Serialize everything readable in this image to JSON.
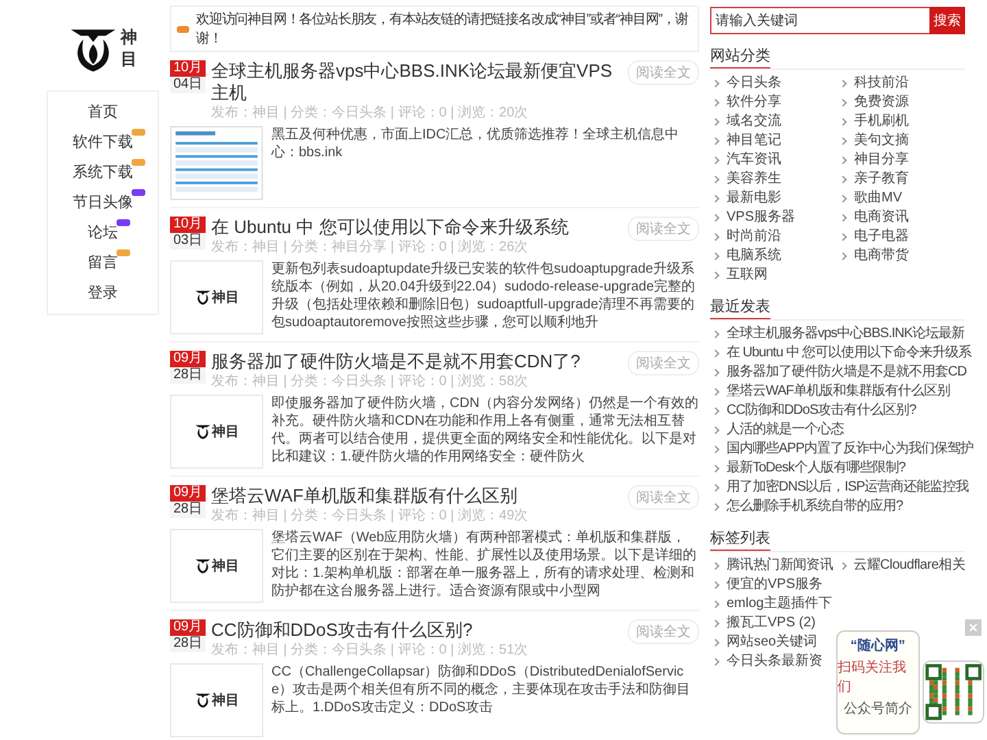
{
  "logo": {
    "text": "神目"
  },
  "nav": [
    {
      "label": "首页"
    },
    {
      "label": "软件下载",
      "color": "#f0a640"
    },
    {
      "label": "系统下载",
      "color": "#f0a640"
    },
    {
      "label": "节日头像",
      "color": "#7a3cf0"
    },
    {
      "label": "论坛",
      "color": "#7a3cf0"
    },
    {
      "label": "留言",
      "color": "#f0a640"
    },
    {
      "label": "登录"
    }
  ],
  "notice": "欢迎访问神目网！各位站长朋友，有本站友链的请把链接名改成“神目”或者“神目网”，谢谢！",
  "posts": [
    {
      "month": "10月",
      "day": "04日",
      "title": "全球主机服务器vps中心BBS.INK论坛最新便宜VPS主机",
      "meta": "发布：神目 | 分类：今日头条 | 评论：0 | 浏览：20次",
      "read": "阅读全文",
      "thumb": {
        "kind": "table"
      },
      "excerpt": "黑五及何种优惠，市面上IDC汇总，优质筛选推荐！全球主机信息中心：bbs.ink"
    },
    {
      "month": "10月",
      "day": "03日",
      "title": "在 Ubuntu 中 您可以使用以下命令来升级系统",
      "meta": "发布：神目 | 分类：神目分享 | 评论：0 | 浏览：26次",
      "read": "阅读全文",
      "thumb": {
        "kind": "logo",
        "text": "神目"
      },
      "excerpt": "更新包列表sudoaptupdate升级已安装的软件包sudoaptupgrade升级系统版本（例如，从20.04升级到22.04）sudodo-release-upgrade完整的升级（包括处理依赖和删除旧包）sudoaptfull-upgrade清理不再需要的包sudoaptautoremove按照这些步骤，您可以顺利地升"
    },
    {
      "month": "09月",
      "day": "28日",
      "title": "服务器加了硬件防火墙是不是就不用套CDN了?",
      "meta": "发布：神目 | 分类：今日头条 | 评论：0 | 浏览：58次",
      "read": "阅读全文",
      "thumb": {
        "kind": "logo",
        "text": "神目"
      },
      "excerpt": "即使服务器加了硬件防火墙，CDN（内容分发网络）仍然是一个有效的补充。硬件防火墙和CDN在功能和作用上各有侧重，通常无法相互替代。两者可以结合使用，提供更全面的网络安全和性能优化。以下是对比和建议：1.硬件防火墙的作用网络安全：硬件防火"
    },
    {
      "month": "09月",
      "day": "28日",
      "title": "堡塔云WAF单机版和集群版有什么区别",
      "meta": "发布：神目 | 分类：今日头条 | 评论：0 | 浏览：49次",
      "read": "阅读全文",
      "thumb": {
        "kind": "logo",
        "text": "神目"
      },
      "excerpt": "堡塔云WAF（Web应用防火墙）有两种部署模式：单机版和集群版，它们主要的区别在于架构、性能、扩展性以及使用场景。以下是详细的对比：1.架构单机版：部署在单一服务器上，所有的请求处理、检测和防护都在这台服务器上进行。适合资源有限或中小型网"
    },
    {
      "month": "09月",
      "day": "28日",
      "title": "CC防御和DDoS攻击有什么区别?",
      "meta": "发布：神目 | 分类：今日头条 | 评论：0 | 浏览：51次",
      "read": "阅读全文",
      "thumb": {
        "kind": "logo",
        "text": "神目"
      },
      "excerpt": "CC（ChallengeCollapsar）防御和DDoS（DistributedDenialofService）攻击是两个相关但有所不同的概念，主要体现在攻击手法和防御目标上。1.DDoS攻击定义：DDoS攻击"
    }
  ],
  "search": {
    "placeholder": "请输入关键词",
    "button": "搜索"
  },
  "categories": {
    "title": "网站分类",
    "items": [
      "今日头条",
      "科技前沿",
      "软件分享",
      "免费资源",
      "域名交流",
      "手机刷机",
      "神目笔记",
      "美句文摘",
      "汽车资讯",
      "神目分享",
      "美容养生",
      "亲子教育",
      "最新电影",
      "歌曲MV",
      "VPS服务器",
      "电商资讯",
      "时尚前沿",
      "电子电器",
      "电脑系统",
      "电商带货",
      "互联网"
    ]
  },
  "recent": {
    "title": "最近发表",
    "items": [
      "全球主机服务器vps中心BBS.INK论坛最新",
      "在 Ubuntu 中 您可以使用以下命令来升级系",
      "服务器加了硬件防火墙是不是就不用套CD",
      "堡塔云WAF单机版和集群版有什么区别",
      "CC防御和DDoS攻击有什么区别?",
      "人活的就是一个心态",
      "国内哪些APP内置了反诈中心为我们保驾护",
      "最新ToDesk个人版有哪些限制?",
      "用了加密DNS以后，ISP运营商还能监控我",
      "怎么删除手机系统自带的应用?"
    ]
  },
  "tags": {
    "title": "标签列表",
    "items": [
      "腾讯热门新闻资讯",
      "云耀Cloudflare相关",
      "便宜的VPS服务",
      "emlog主题插件下",
      "搬瓦工VPS (2)",
      "网站seo关键词",
      "今日头条最新资"
    ]
  },
  "popup": {
    "name": "“随心网”",
    "slogan": "扫码关注我们",
    "intro_title": "公众号简介"
  }
}
